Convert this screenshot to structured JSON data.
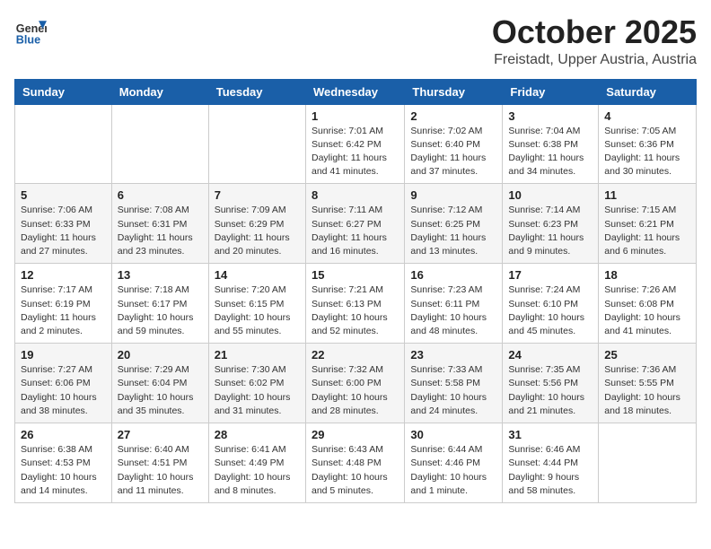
{
  "header": {
    "logo_general": "General",
    "logo_blue": "Blue",
    "month_title": "October 2025",
    "location": "Freistadt, Upper Austria, Austria"
  },
  "weekdays": [
    "Sunday",
    "Monday",
    "Tuesday",
    "Wednesday",
    "Thursday",
    "Friday",
    "Saturday"
  ],
  "weeks": [
    [
      {
        "day": "",
        "info": ""
      },
      {
        "day": "",
        "info": ""
      },
      {
        "day": "",
        "info": ""
      },
      {
        "day": "1",
        "info": "Sunrise: 7:01 AM\nSunset: 6:42 PM\nDaylight: 11 hours\nand 41 minutes."
      },
      {
        "day": "2",
        "info": "Sunrise: 7:02 AM\nSunset: 6:40 PM\nDaylight: 11 hours\nand 37 minutes."
      },
      {
        "day": "3",
        "info": "Sunrise: 7:04 AM\nSunset: 6:38 PM\nDaylight: 11 hours\nand 34 minutes."
      },
      {
        "day": "4",
        "info": "Sunrise: 7:05 AM\nSunset: 6:36 PM\nDaylight: 11 hours\nand 30 minutes."
      }
    ],
    [
      {
        "day": "5",
        "info": "Sunrise: 7:06 AM\nSunset: 6:33 PM\nDaylight: 11 hours\nand 27 minutes."
      },
      {
        "day": "6",
        "info": "Sunrise: 7:08 AM\nSunset: 6:31 PM\nDaylight: 11 hours\nand 23 minutes."
      },
      {
        "day": "7",
        "info": "Sunrise: 7:09 AM\nSunset: 6:29 PM\nDaylight: 11 hours\nand 20 minutes."
      },
      {
        "day": "8",
        "info": "Sunrise: 7:11 AM\nSunset: 6:27 PM\nDaylight: 11 hours\nand 16 minutes."
      },
      {
        "day": "9",
        "info": "Sunrise: 7:12 AM\nSunset: 6:25 PM\nDaylight: 11 hours\nand 13 minutes."
      },
      {
        "day": "10",
        "info": "Sunrise: 7:14 AM\nSunset: 6:23 PM\nDaylight: 11 hours\nand 9 minutes."
      },
      {
        "day": "11",
        "info": "Sunrise: 7:15 AM\nSunset: 6:21 PM\nDaylight: 11 hours\nand 6 minutes."
      }
    ],
    [
      {
        "day": "12",
        "info": "Sunrise: 7:17 AM\nSunset: 6:19 PM\nDaylight: 11 hours\nand 2 minutes."
      },
      {
        "day": "13",
        "info": "Sunrise: 7:18 AM\nSunset: 6:17 PM\nDaylight: 10 hours\nand 59 minutes."
      },
      {
        "day": "14",
        "info": "Sunrise: 7:20 AM\nSunset: 6:15 PM\nDaylight: 10 hours\nand 55 minutes."
      },
      {
        "day": "15",
        "info": "Sunrise: 7:21 AM\nSunset: 6:13 PM\nDaylight: 10 hours\nand 52 minutes."
      },
      {
        "day": "16",
        "info": "Sunrise: 7:23 AM\nSunset: 6:11 PM\nDaylight: 10 hours\nand 48 minutes."
      },
      {
        "day": "17",
        "info": "Sunrise: 7:24 AM\nSunset: 6:10 PM\nDaylight: 10 hours\nand 45 minutes."
      },
      {
        "day": "18",
        "info": "Sunrise: 7:26 AM\nSunset: 6:08 PM\nDaylight: 10 hours\nand 41 minutes."
      }
    ],
    [
      {
        "day": "19",
        "info": "Sunrise: 7:27 AM\nSunset: 6:06 PM\nDaylight: 10 hours\nand 38 minutes."
      },
      {
        "day": "20",
        "info": "Sunrise: 7:29 AM\nSunset: 6:04 PM\nDaylight: 10 hours\nand 35 minutes."
      },
      {
        "day": "21",
        "info": "Sunrise: 7:30 AM\nSunset: 6:02 PM\nDaylight: 10 hours\nand 31 minutes."
      },
      {
        "day": "22",
        "info": "Sunrise: 7:32 AM\nSunset: 6:00 PM\nDaylight: 10 hours\nand 28 minutes."
      },
      {
        "day": "23",
        "info": "Sunrise: 7:33 AM\nSunset: 5:58 PM\nDaylight: 10 hours\nand 24 minutes."
      },
      {
        "day": "24",
        "info": "Sunrise: 7:35 AM\nSunset: 5:56 PM\nDaylight: 10 hours\nand 21 minutes."
      },
      {
        "day": "25",
        "info": "Sunrise: 7:36 AM\nSunset: 5:55 PM\nDaylight: 10 hours\nand 18 minutes."
      }
    ],
    [
      {
        "day": "26",
        "info": "Sunrise: 6:38 AM\nSunset: 4:53 PM\nDaylight: 10 hours\nand 14 minutes."
      },
      {
        "day": "27",
        "info": "Sunrise: 6:40 AM\nSunset: 4:51 PM\nDaylight: 10 hours\nand 11 minutes."
      },
      {
        "day": "28",
        "info": "Sunrise: 6:41 AM\nSunset: 4:49 PM\nDaylight: 10 hours\nand 8 minutes."
      },
      {
        "day": "29",
        "info": "Sunrise: 6:43 AM\nSunset: 4:48 PM\nDaylight: 10 hours\nand 5 minutes."
      },
      {
        "day": "30",
        "info": "Sunrise: 6:44 AM\nSunset: 4:46 PM\nDaylight: 10 hours\nand 1 minute."
      },
      {
        "day": "31",
        "info": "Sunrise: 6:46 AM\nSunset: 4:44 PM\nDaylight: 9 hours\nand 58 minutes."
      },
      {
        "day": "",
        "info": ""
      }
    ]
  ]
}
